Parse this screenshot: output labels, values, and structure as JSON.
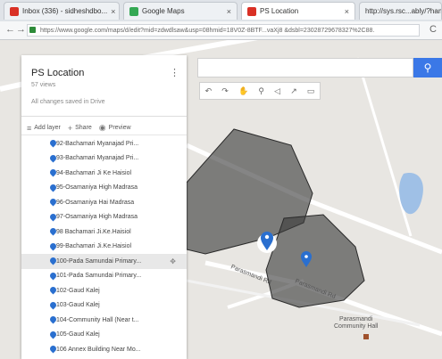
{
  "browser": {
    "tabs": [
      {
        "label": "Inbox (336) - sidheshdbo...",
        "color": "#d93025"
      },
      {
        "label": "Google Maps",
        "color": "#34a853"
      },
      {
        "label": "PS Location",
        "color": "#d93025"
      },
      {
        "label": "http://sys.rsc...ably/?hamie",
        "color": "#9aa0a6"
      }
    ],
    "tab_close": "×",
    "url": "https://www.google.com/maps/d/edit?mid=zdwdlsaw&usp=08hmid=18V0Z-8BTF...vaXj8 &dsbl=23028729678327%2C88.",
    "nav_back": "←",
    "nav_forward": "→",
    "reload": "C"
  },
  "map": {
    "search_placeholder": "",
    "search_icon": "search-icon",
    "toolbar_icons": [
      "↶",
      "↷",
      "✋",
      "⚲",
      "◁",
      "↗",
      "▭"
    ],
    "road_labels": [
      "Parasmandi Rd",
      "Parasmandi Rd"
    ],
    "poi_label_line1": "Parasmandi",
    "poi_label_line2": "Community Hall",
    "colors": {
      "polygon": "#3a3a3a",
      "marker": "#2a6fcf",
      "water": "#9fc0e6"
    }
  },
  "panel": {
    "title": "PS Location",
    "views": "57 views",
    "menu_glyph": "⋮",
    "saved_status": "All changes saved in Drive",
    "actions": [
      {
        "icon": "≡",
        "label": "Add layer"
      },
      {
        "icon": "+",
        "label": "Share"
      },
      {
        "icon": "◉",
        "label": "Preview"
      }
    ],
    "items": [
      {
        "label": "92-Bachamari Myanajad Pri...",
        "selected": false
      },
      {
        "label": "93-Bachamari Myanajad Pri...",
        "selected": false
      },
      {
        "label": "94-Bachamari Ji Ke Haisiol",
        "selected": false
      },
      {
        "label": "95-Osamaniya High Madrasa",
        "selected": false
      },
      {
        "label": "96-Osamaniya Hai Madrasa",
        "selected": false
      },
      {
        "label": "97-Osamaniya High Madrasa",
        "selected": false
      },
      {
        "label": "98 Bachamari Ji.Ke.Haisiol",
        "selected": false
      },
      {
        "label": "99-Bachamari Ji.Ke.Haisiol",
        "selected": false
      },
      {
        "label": "100-Pada Samundai Primary...",
        "selected": true,
        "style_icon": "✥"
      },
      {
        "label": "101-Pada Samundai Primary...",
        "selected": false
      },
      {
        "label": "102-Gaud Kalej",
        "selected": false
      },
      {
        "label": "103-Gaud Kalej",
        "selected": false
      },
      {
        "label": "104-Community Hall (Near t...",
        "selected": false
      },
      {
        "label": "105-Gaud Kalej",
        "selected": false
      },
      {
        "label": "106 Annex Building Near Mo...",
        "selected": false
      }
    ]
  }
}
